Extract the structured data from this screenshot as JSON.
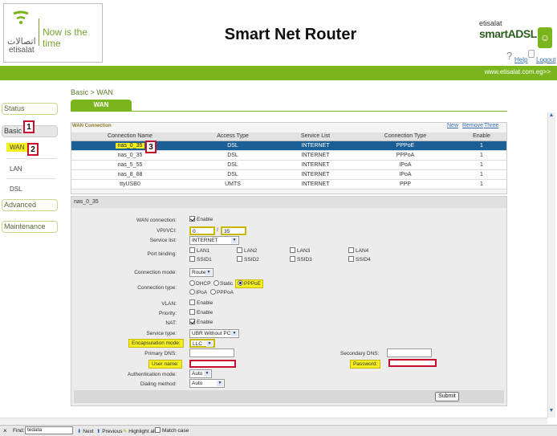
{
  "header": {
    "logo_arabic": "اتصالات",
    "logo_english": "etisalat",
    "tagline": "Now is the time",
    "title": "Smart Net Router",
    "brand_small": "etisalat",
    "brand_big": "smartADSL",
    "help_label": "Help",
    "logout_label": "Logout",
    "site_url": "www.etisalat.com.eg>>"
  },
  "nav": {
    "status": "Status",
    "basic": "Basic",
    "wan": "WAN",
    "lan": "LAN",
    "dsl": "DSL",
    "advanced": "Advanced",
    "maintenance": "Maintenance"
  },
  "annotations": {
    "one": "1",
    "two": "2",
    "three": "3"
  },
  "breadcrumb": "Basic > WAN",
  "tab_label": "WAN",
  "connections": {
    "title": "WAN Connection",
    "actions": {
      "new": "New",
      "remove": "Remove",
      "three": "Three"
    },
    "headers": [
      "Connection Name",
      "Access Type",
      "Service List",
      "Connection Type",
      "Enable"
    ],
    "rows": [
      {
        "name": "nas_0_35",
        "access": "DSL",
        "service": "INTERNET",
        "type": "PPPoE",
        "enable": "1"
      },
      {
        "name": "nas_0_35",
        "access": "DSL",
        "service": "INTERNET",
        "type": "PPPoA",
        "enable": "1"
      },
      {
        "name": "nas_5_55",
        "access": "DSL",
        "service": "INTERNET",
        "type": "IPoA",
        "enable": "1"
      },
      {
        "name": "nas_8_88",
        "access": "DSL",
        "service": "INTERNET",
        "type": "IPoA",
        "enable": "1"
      },
      {
        "name": "ttyUSB0",
        "access": "UMTS",
        "service": "INTERNET",
        "type": "PPP",
        "enable": "1"
      }
    ]
  },
  "detail": {
    "header": "nas_0_35",
    "wan_connection_label": "WAN connection:",
    "enable_label": "Enable",
    "vpi_vci_label": "VPI/VCI:",
    "vpi_value": "0",
    "vci_value": "35",
    "service_list_label": "Service list:",
    "service_list_value": "INTERNET",
    "port_binding_label": "Port binding:",
    "ports": [
      "LAN1",
      "LAN2",
      "LAN3",
      "LAN4",
      "SSID1",
      "SSID2",
      "SSID3",
      "SSID4"
    ],
    "connection_mode_label": "Connection mode:",
    "connection_mode_value": "Route",
    "connection_type_label": "Connection type:",
    "types": [
      "DHCP",
      "Static",
      "PPPoE",
      "IPoA",
      "PPPoA"
    ],
    "vlan_label": "VLAN:",
    "priority_label": "Priority:",
    "nat_label": "NAT:",
    "service_type_label": "Service type:",
    "service_type_value": "UBR Without PCR",
    "encapsulation_label": "Encapsulation mode:",
    "encapsulation_value": "LLC",
    "primary_dns_label": "Primary DNS:",
    "secondary_dns_label": "Secondary DNS:",
    "username_label": "User name:",
    "password_label": "Password:",
    "auth_mode_label": "Authentication mode:",
    "auth_mode_value": "Auto",
    "dialing_label": "Dialing method:",
    "dialing_value": "Auto",
    "submit_label": "Submit"
  },
  "findbar": {
    "close": "×",
    "find_label": "Find:",
    "find_value": "tedata",
    "next": "Next",
    "previous": "Previous",
    "highlight": "Highlight all",
    "match_case": "Match case"
  }
}
